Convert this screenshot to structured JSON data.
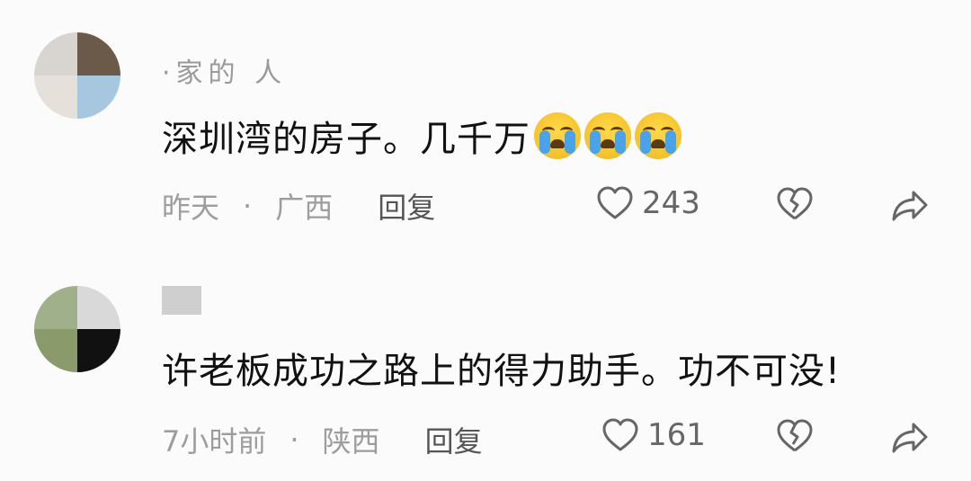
{
  "comments": [
    {
      "username": "·家的  人",
      "text": "深圳湾的房子。几千万",
      "emoji_count": 3,
      "emoji_icon": "loudly-crying-face-icon",
      "time": "昨天",
      "location": "广西",
      "reply_label": "回复",
      "like_count": "243"
    },
    {
      "username": "",
      "text": "许老板成功之路上的得力助手。功不可没!",
      "time": "7小时前",
      "location": "陕西",
      "reply_label": "回复",
      "like_count": "161"
    }
  ],
  "separator": "·",
  "icons": {
    "like": "heart-outline-icon",
    "dislike": "broken-heart-icon",
    "share": "share-arrow-icon"
  },
  "colors": {
    "background": "#fbfbfb",
    "meta_text": "#9d9d9d",
    "body_text": "#111111"
  }
}
